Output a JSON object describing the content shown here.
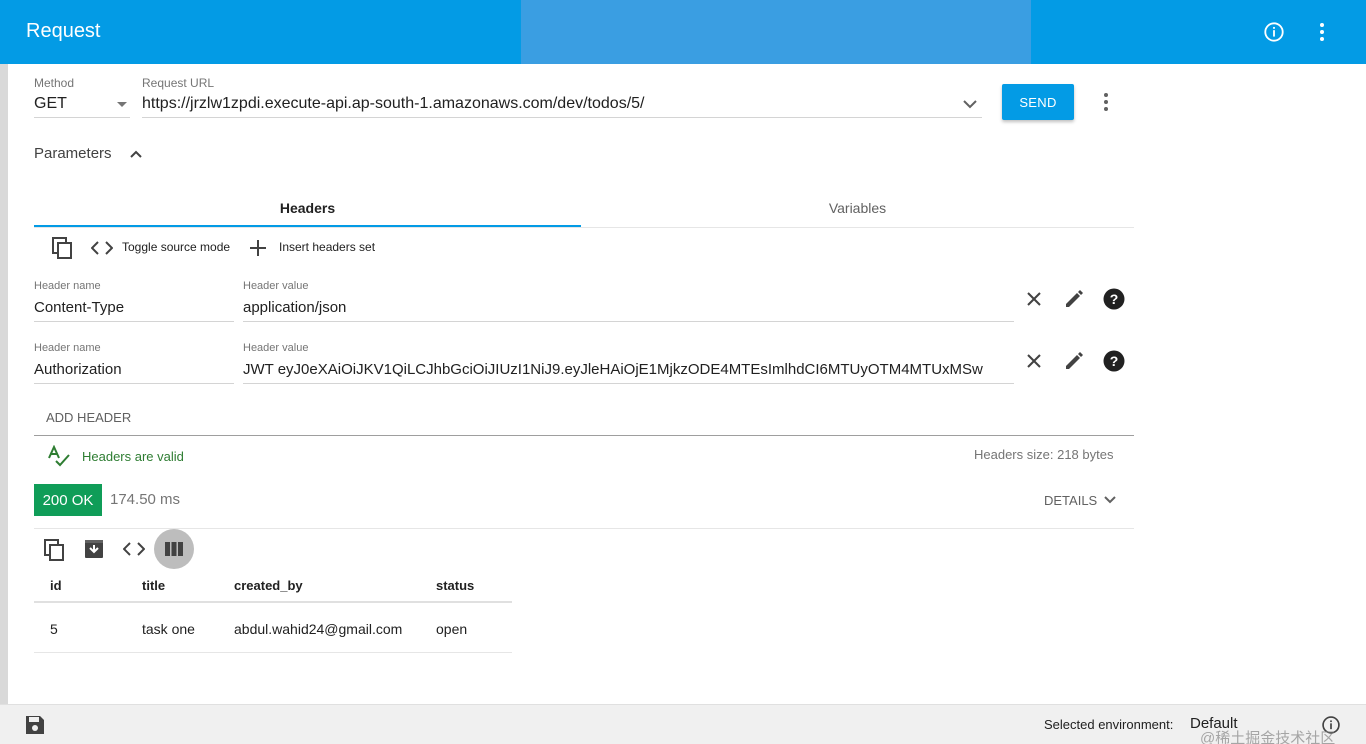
{
  "appbar": {
    "title": "Request",
    "info_icon": "info-icon",
    "menu_icon": "more-vert-icon"
  },
  "request": {
    "method_label": "Method",
    "method_value": "GET",
    "url_label": "Request URL",
    "url_value": "https://jrzlw1zpdi.execute-api.ap-south-1.amazonaws.com/dev/todos/5/",
    "send_label": "SEND"
  },
  "parameters": {
    "label": "Parameters",
    "tabs": [
      "Headers",
      "Variables"
    ],
    "active_tab": "Headers"
  },
  "toolbar": {
    "toggle_label": "Toggle source mode",
    "insert_label": "Insert headers set"
  },
  "headers": [
    {
      "name_label": "Header name",
      "name": "Content-Type",
      "value_label": "Header value",
      "value": "application/json"
    },
    {
      "name_label": "Header name",
      "name": "Authorization",
      "value_label": "Header value",
      "value": "JWT eyJ0eXAiOiJKV1QiLCJhbGciOiJIUzI1NiJ9.eyJleHAiOjE1MjkzODE4MTEsImlhdCI6MTUyOTM4MTUxMSw"
    }
  ],
  "add_header_label": "ADD HEADER",
  "validation": {
    "valid_text": "Headers are valid",
    "size_text": "Headers size: 218 bytes"
  },
  "response": {
    "status": "200 OK",
    "time": "174.50 ms",
    "details_label": "DETAILS"
  },
  "table": {
    "columns": [
      "id",
      "title",
      "created_by",
      "status"
    ],
    "rows": [
      [
        "5",
        "task one",
        "abdul.wahid24@gmail.com",
        "open"
      ]
    ]
  },
  "footer": {
    "env_label": "Selected environment:",
    "env_value": "Default",
    "watermark": "@稀土掘金技术社区"
  },
  "colors": {
    "primary": "#039be5",
    "success": "#0f9d58",
    "valid_text": "#2e7d32"
  }
}
